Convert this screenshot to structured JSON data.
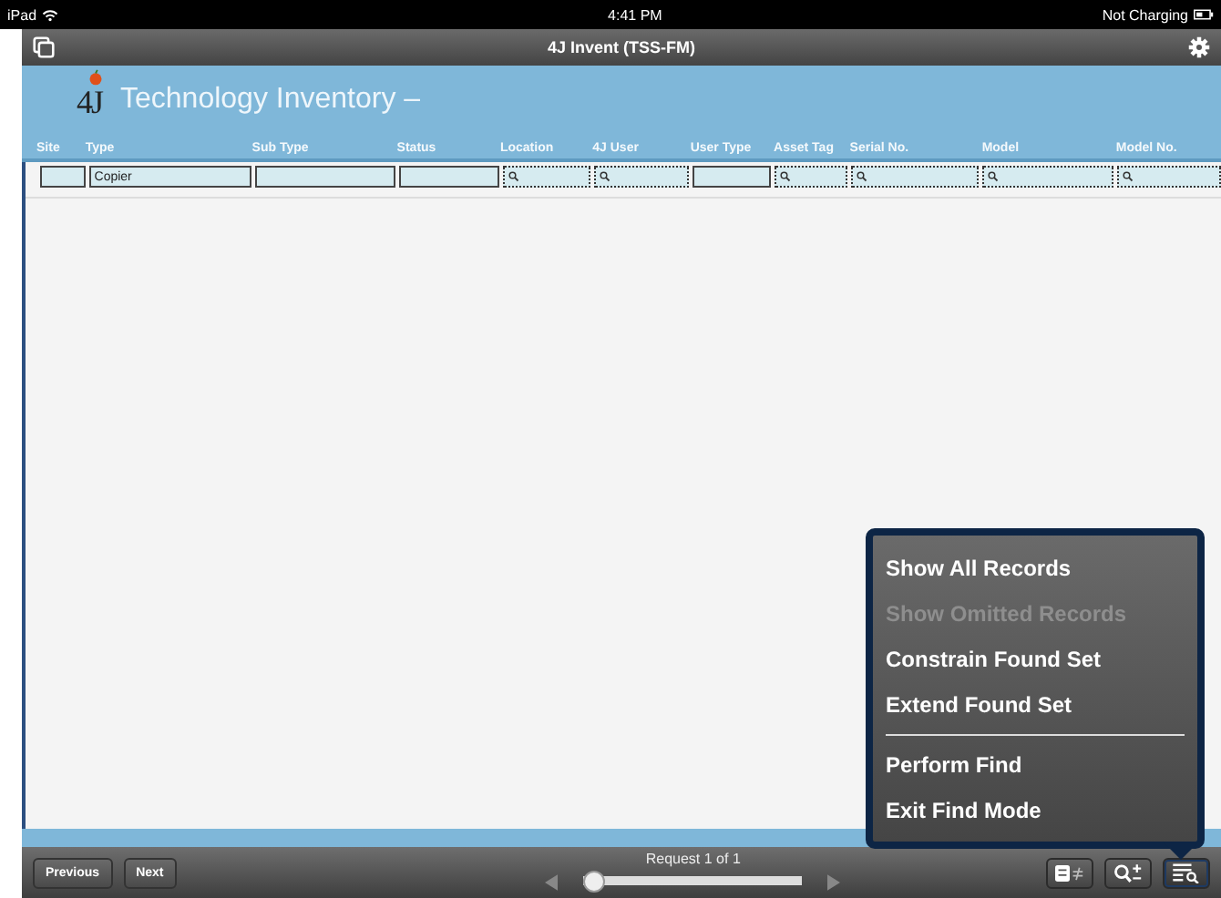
{
  "status_bar": {
    "device": "iPad",
    "time": "4:41 PM",
    "battery": "Not Charging"
  },
  "window": {
    "title": "4J Invent (TSS-FM)"
  },
  "header": {
    "logo": "4J",
    "title": "Technology Inventory –"
  },
  "columns": [
    {
      "label": "Site",
      "field": {
        "kind": "plain"
      }
    },
    {
      "label": "Type",
      "field": {
        "kind": "plain",
        "value": "Copier"
      }
    },
    {
      "label": "Sub Type",
      "field": {
        "kind": "plain"
      }
    },
    {
      "label": "Status",
      "field": {
        "kind": "plain"
      }
    },
    {
      "label": "Location",
      "field": {
        "kind": "search"
      }
    },
    {
      "label": "4J User",
      "field": {
        "kind": "search"
      }
    },
    {
      "label": "User Type",
      "field": {
        "kind": "plain"
      }
    },
    {
      "label": "Asset Tag",
      "field": {
        "kind": "search"
      }
    },
    {
      "label": "Serial No.",
      "field": {
        "kind": "search"
      }
    },
    {
      "label": "Model",
      "field": {
        "kind": "search"
      }
    },
    {
      "label": "Model No.",
      "field": {
        "kind": "search"
      }
    }
  ],
  "menu": {
    "groups": [
      [
        {
          "label": "Show All Records",
          "disabled": false
        },
        {
          "label": "Show Omitted Records",
          "disabled": true
        },
        {
          "label": "Constrain Found Set",
          "disabled": false
        },
        {
          "label": "Extend Found Set",
          "disabled": false
        }
      ],
      [
        {
          "label": "Perform Find",
          "disabled": false
        },
        {
          "label": "Exit Find Mode",
          "disabled": false
        }
      ]
    ]
  },
  "toolbar": {
    "buttons": [
      {
        "label": "Previous"
      },
      {
        "label": "Next"
      }
    ],
    "request": "Request 1 of 1",
    "slider": {
      "level": 0
    },
    "tools": [
      {
        "kind": "omit",
        "selected": false
      },
      {
        "kind": "zoom",
        "selected": false
      },
      {
        "kind": "find",
        "selected": true
      }
    ]
  }
}
